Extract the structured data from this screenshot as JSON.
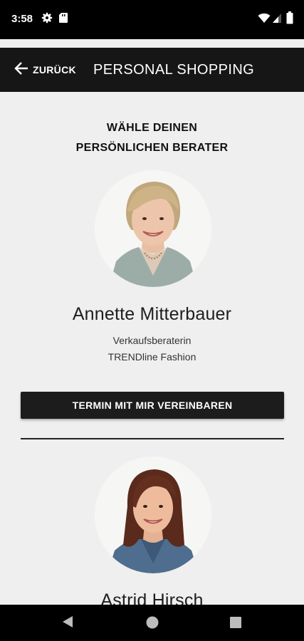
{
  "status_bar": {
    "time": "3:58",
    "left_icons": [
      "gear-icon",
      "sd-card-icon"
    ],
    "right_icons": [
      "wifi-icon",
      "signal-icon",
      "battery-icon"
    ]
  },
  "app_bar": {
    "back_label": "ZURÜCK",
    "title": "PERSONAL SHOPPING",
    "background": "#161616"
  },
  "main": {
    "heading_line1": "WÄHLE DEINEN",
    "heading_line2": "PERSÖNLICHEN BERATER",
    "advisors": [
      {
        "name": "Annette Mitterbauer",
        "role": "Verkaufsberaterin",
        "department": "TRENDline Fashion",
        "button_label": "TERMIN MIT MIR VEREINBAREN"
      },
      {
        "name": "Astrid Hirsch"
      }
    ]
  },
  "nav_bar": {
    "buttons": [
      "back-triangle-icon",
      "home-circle-icon",
      "recents-square-icon"
    ]
  },
  "colors": {
    "page_background": "#efefef",
    "button_background": "#1c1c1c",
    "bars": "#000000"
  }
}
